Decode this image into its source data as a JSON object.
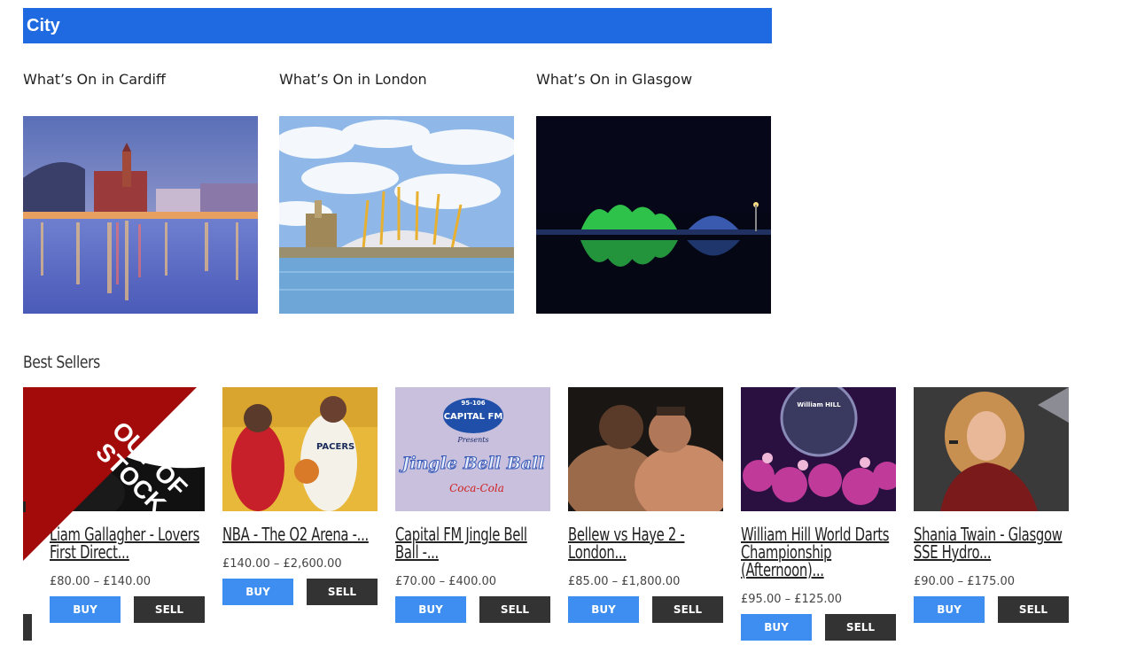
{
  "city_section": {
    "heading": "City",
    "cities": [
      {
        "title": "What’s On in Cardiff"
      },
      {
        "title": "What’s On in London"
      },
      {
        "title": "What’s On in Glasgow"
      }
    ]
  },
  "best_sellers": {
    "heading": "Best Sellers",
    "out_of_stock_badge": "OUT OF STOCK",
    "products": [
      {
        "name": "Liam Gallagher - Lovers First Direct...",
        "price": "£80.00 – £140.00",
        "buy": "BUY",
        "sell": "SELL"
      },
      {
        "name": "NBA - The O2 Arena -...",
        "price": "£140.00 – £2,600.00",
        "buy": "BUY",
        "sell": "SELL"
      },
      {
        "name": "Capital FM Jingle Bell Ball -...",
        "price": "£70.00 – £400.00",
        "buy": "BUY",
        "sell": "SELL"
      },
      {
        "name": "Bellew vs Haye 2 - London...",
        "price": "£85.00 – £1,800.00",
        "buy": "BUY",
        "sell": "SELL"
      },
      {
        "name": "William Hill World Darts Championship (Afternoon)...",
        "price": "£95.00 – £125.00",
        "buy": "BUY",
        "sell": "SELL"
      },
      {
        "name": "Shania Twain - Glasgow SSE Hydro...",
        "price": "£90.00 – £175.00",
        "buy": "BUY",
        "sell": "SELL"
      }
    ]
  },
  "image_text": {
    "capital_logo": "CAPITAL FM",
    "capital_freq": "95-106",
    "capital_presents": "Presents",
    "jingle": "Jingle Bell Ball",
    "cocacola": "Coca-Cola",
    "jersey": "PACERS",
    "williamhill": "William HILL"
  },
  "colors": {
    "accent": "#1f6ae0",
    "buy": "#3d8ef0",
    "sell": "#333333",
    "badge": "#a30a0a"
  }
}
